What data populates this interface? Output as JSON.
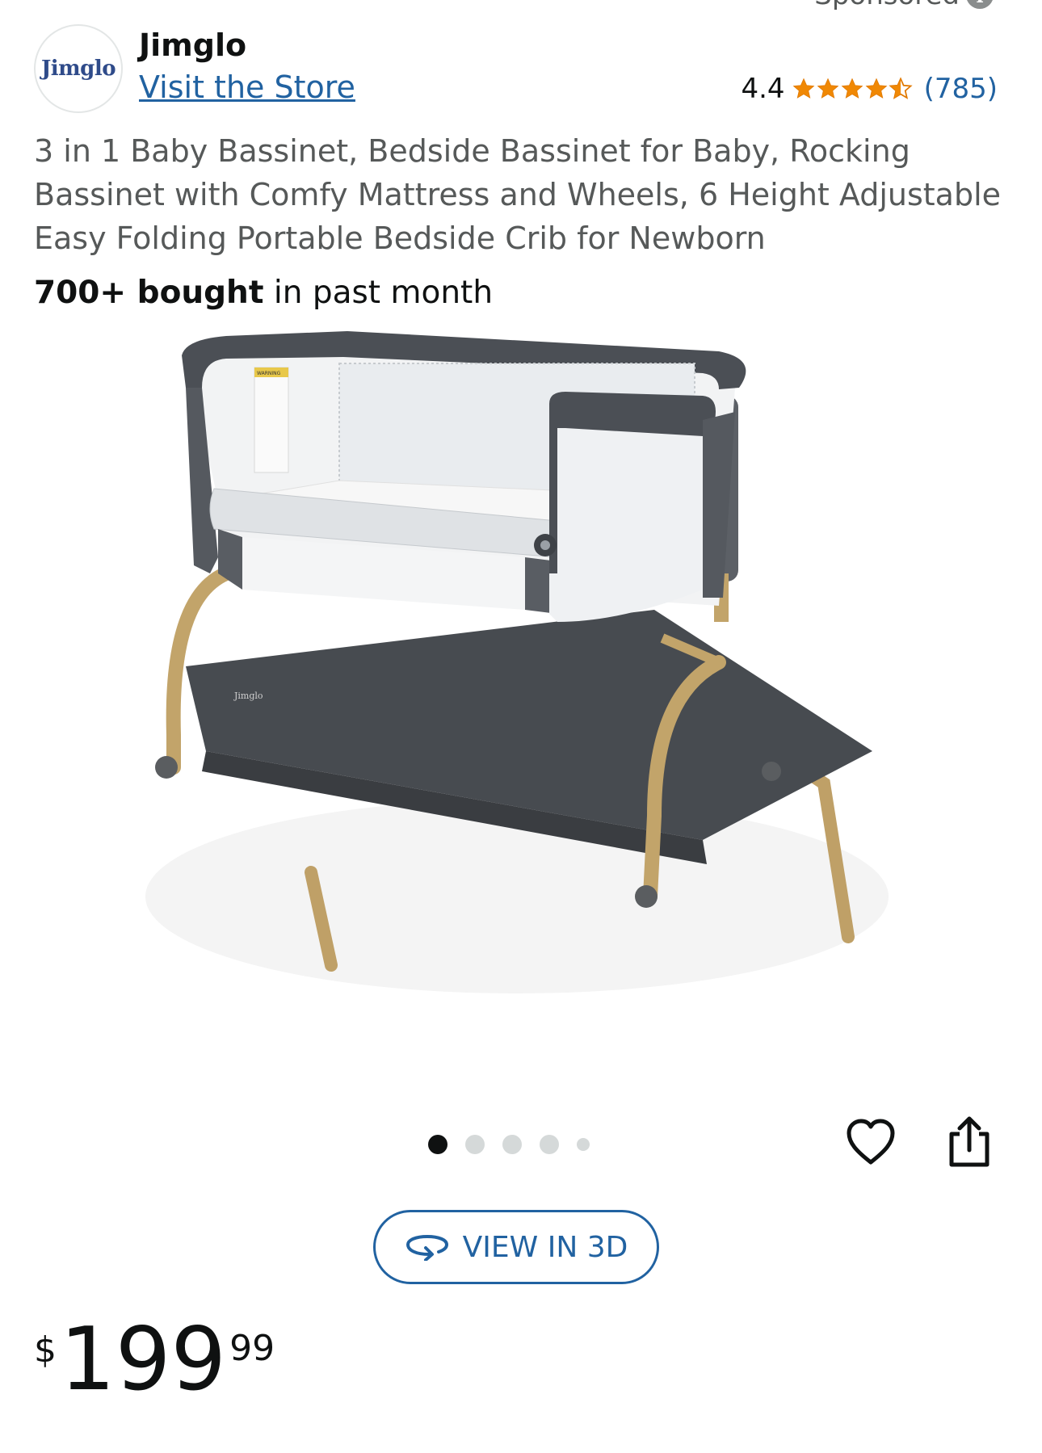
{
  "sponsored": {
    "label": "Sponsored"
  },
  "brand": {
    "logo_text": "Jimglo",
    "name": "Jimglo",
    "store_link": "Visit the Store"
  },
  "rating": {
    "value": "4.4",
    "stars": 4.5,
    "review_count": "(785)",
    "star_color": "#f08804"
  },
  "product": {
    "title": "3 in 1 Baby Bassinet, Bedside Bassinet for Baby, Rocking Bassinet with Comfy Mattress and Wheels, 6 Height Adjustable Easy Folding Portable Bedside Crib for Newborn",
    "bought_strong": "700+ bought",
    "bought_rest": " in past month",
    "image_label": "Jimglo",
    "image_warning": "WARNING"
  },
  "carousel": {
    "count": 5,
    "active_index": 0
  },
  "actions": {
    "view_3d": "VIEW IN 3D",
    "wishlist_icon": "heart-icon",
    "share_icon": "share-icon"
  },
  "price": {
    "symbol": "$",
    "whole": "199",
    "fraction": "99"
  },
  "colors": {
    "link": "#2162a1",
    "text": "#0f1111",
    "muted": "#565959"
  }
}
